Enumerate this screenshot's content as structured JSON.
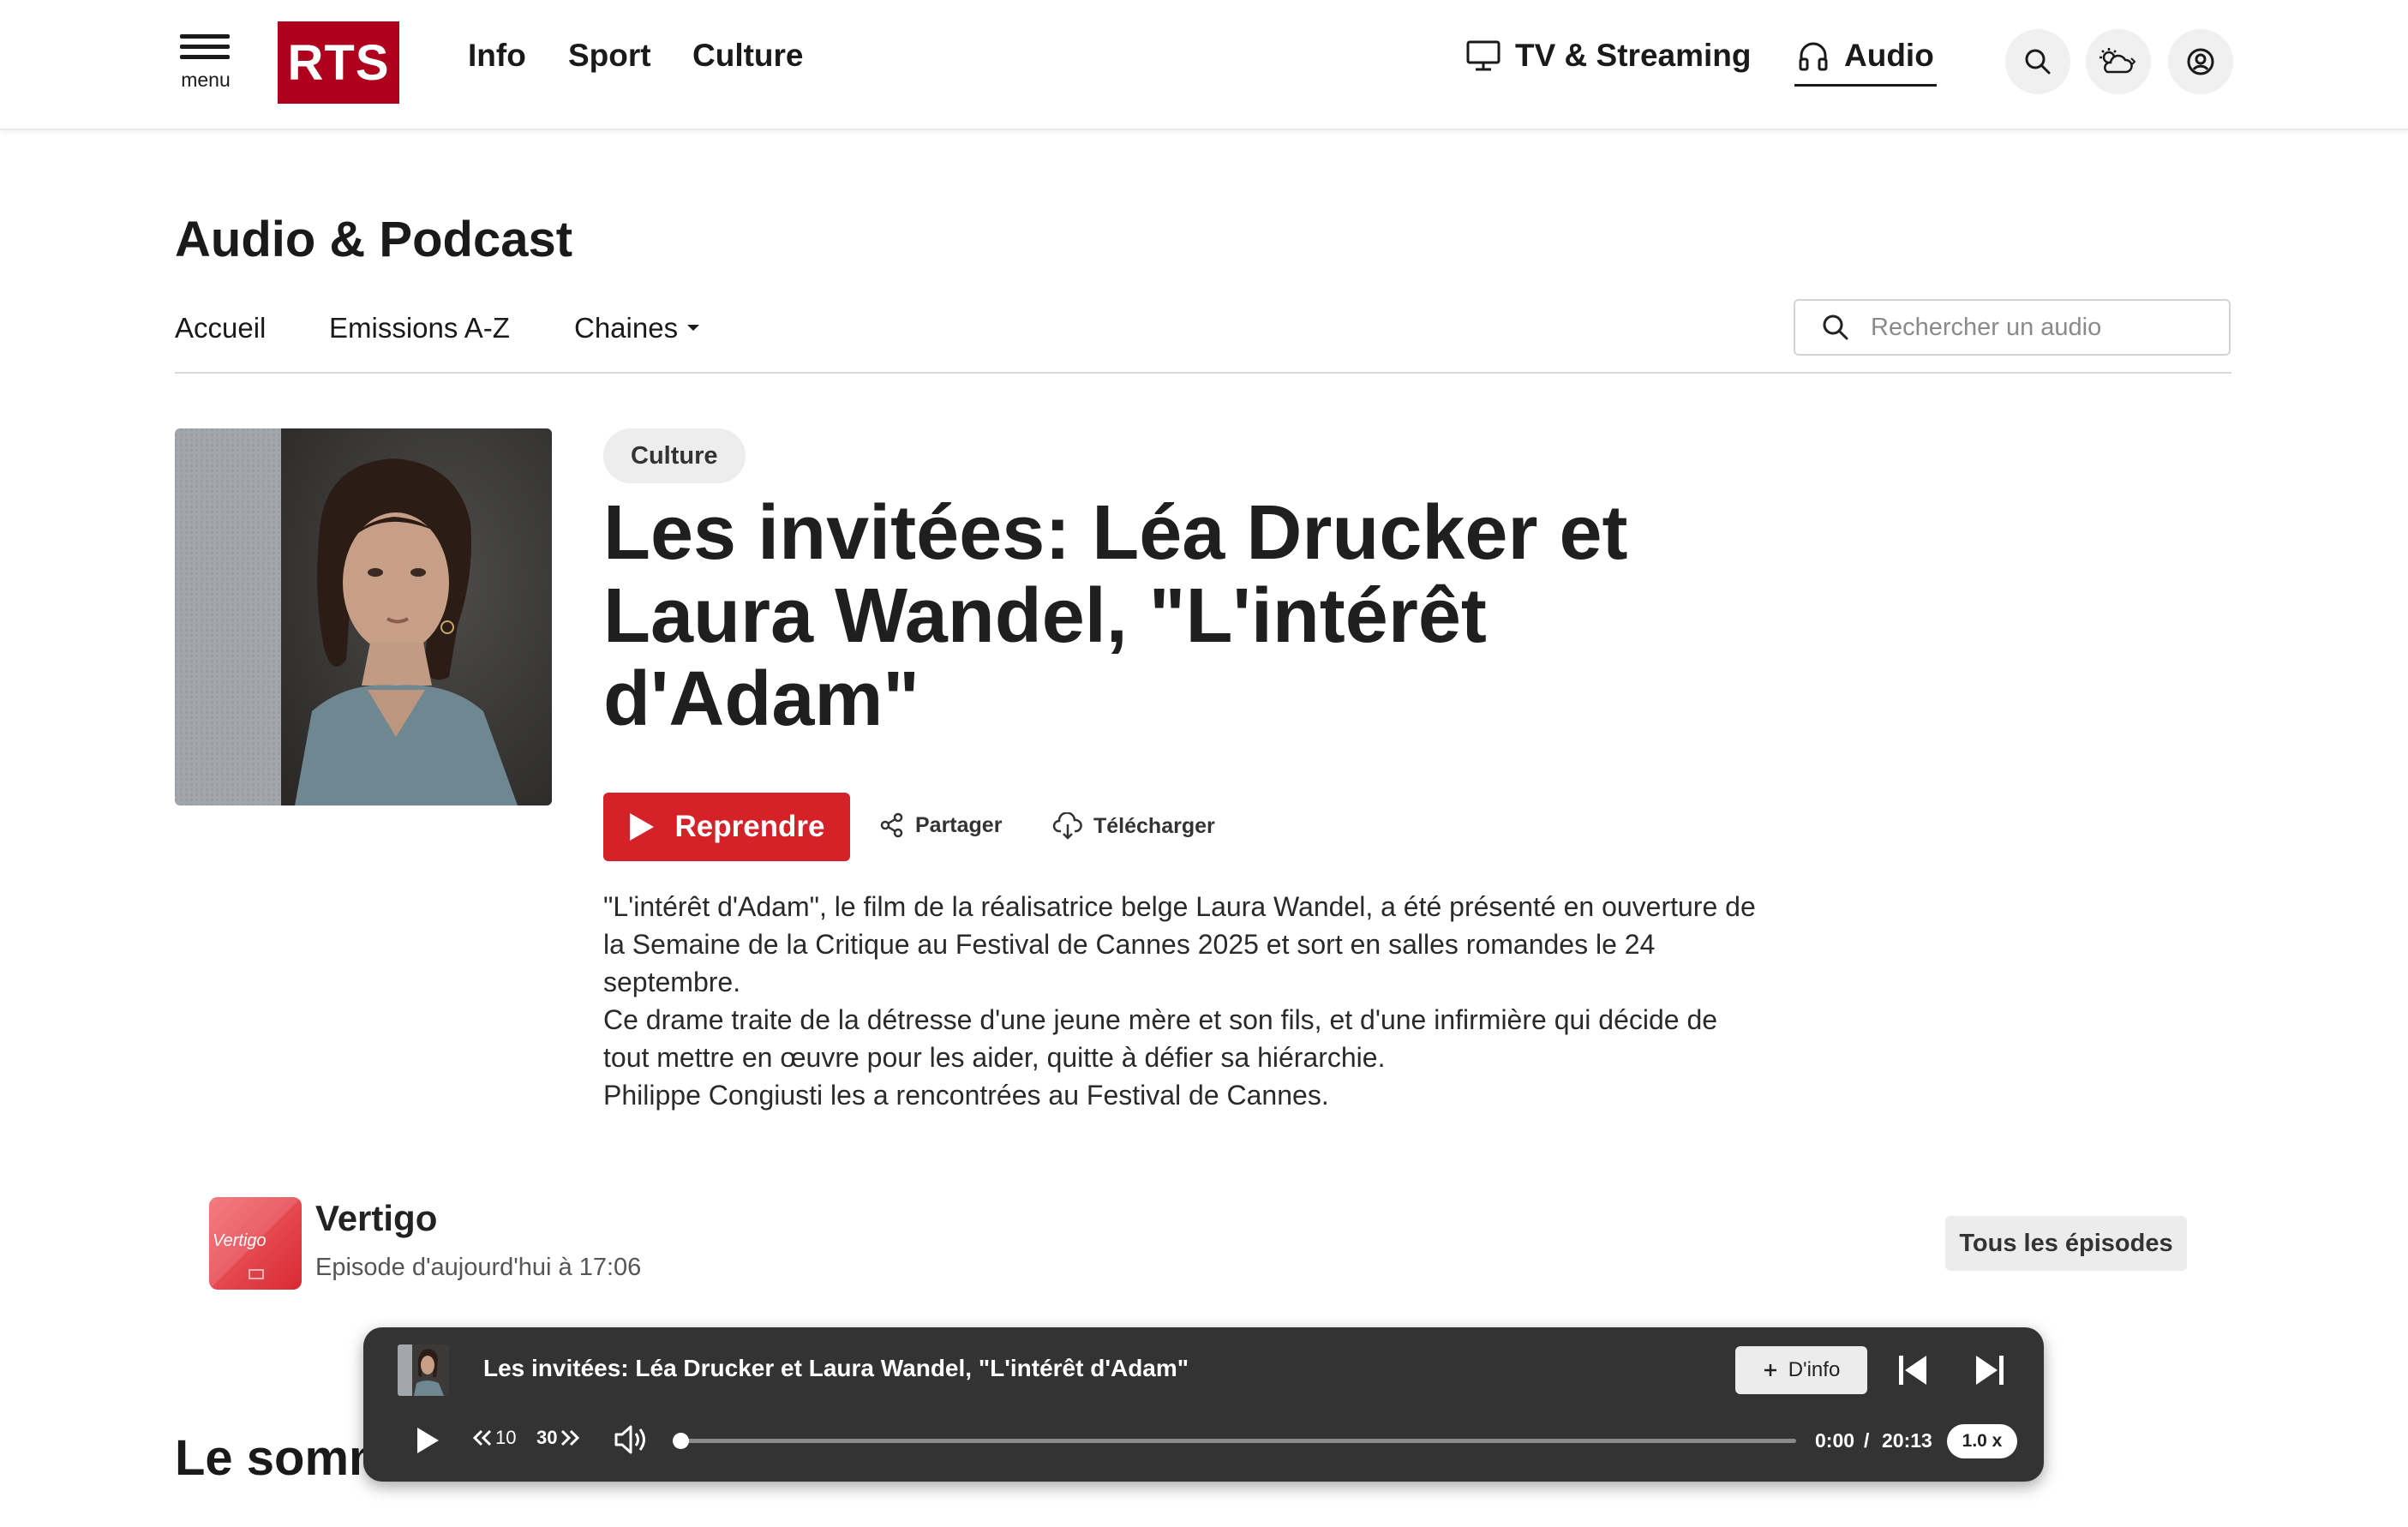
{
  "header": {
    "menu_label": "menu",
    "logo_text": "RTS",
    "nav": [
      "Info",
      "Sport",
      "Culture"
    ],
    "tv_label": "TV & Streaming",
    "audio_label": "Audio"
  },
  "section": {
    "title": "Audio & Podcast",
    "subnav": [
      "Accueil",
      "Emissions A-Z",
      "Chaines"
    ],
    "search_placeholder": "Rechercher un audio"
  },
  "episode": {
    "tag": "Culture",
    "title": "Les invitées: Léa Drucker et Laura Wandel, \"L'intérêt d'Adam\"",
    "play_label": "Reprendre",
    "share_label": "Partager",
    "download_label": "Télécharger",
    "description": [
      "\"L'intérêt d'Adam\", le film de la réalisatrice belge Laura Wandel, a été présenté en ouverture de la Semaine de la Critique au Festival de Cannes 2025 et sort en salles romandes le 24 septembre.",
      "Ce drame traite de la détresse d'une jeune mère et son fils, et d'une infirmière qui décide de tout mettre en œuvre pour les aider, quitte à défier sa hiérarchie.",
      "Philippe Congiusti les a rencontrées au Festival de Cannes."
    ]
  },
  "show": {
    "thumb_text": "Vertigo",
    "name": "Vertigo",
    "subtitle": "Episode d'aujourd'hui à 17:06",
    "all_episodes_label": "Tous les épisodes"
  },
  "next_section_title": "Le sommaire",
  "player": {
    "title": "Les invitées: Léa Drucker et Laura Wandel, \"L'intérêt d'Adam\"",
    "info_label": "D'info",
    "rewind_label": "10",
    "forward_label": "30",
    "current_time": "0:00",
    "separator": "/",
    "duration": "20:13",
    "speed": "1.0 x",
    "progress": 0
  },
  "colors": {
    "brand_red": "#af001e",
    "play_red": "#d52128",
    "player_bg": "#333333"
  }
}
